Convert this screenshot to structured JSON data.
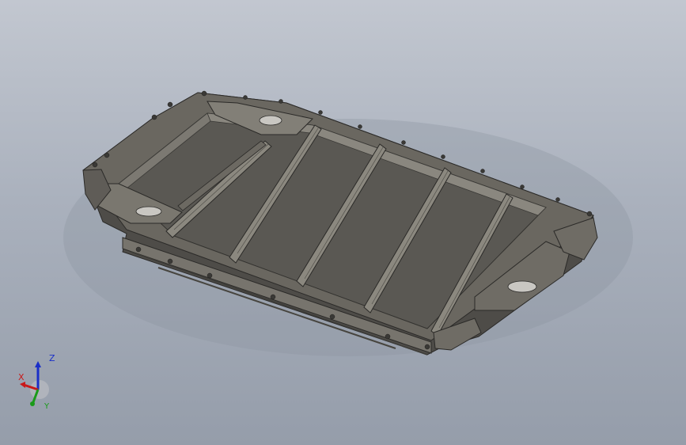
{
  "viewport": {
    "background_top": "#c2c7d0",
    "background_bottom": "#959daa",
    "model_color": "#5f5c57"
  },
  "triad": {
    "x_label": "X",
    "y_label": "Y",
    "z_label": "Z",
    "x_color": "#c81a1a",
    "y_color": "#1a9a1a",
    "z_color": "#1a2fc8"
  }
}
